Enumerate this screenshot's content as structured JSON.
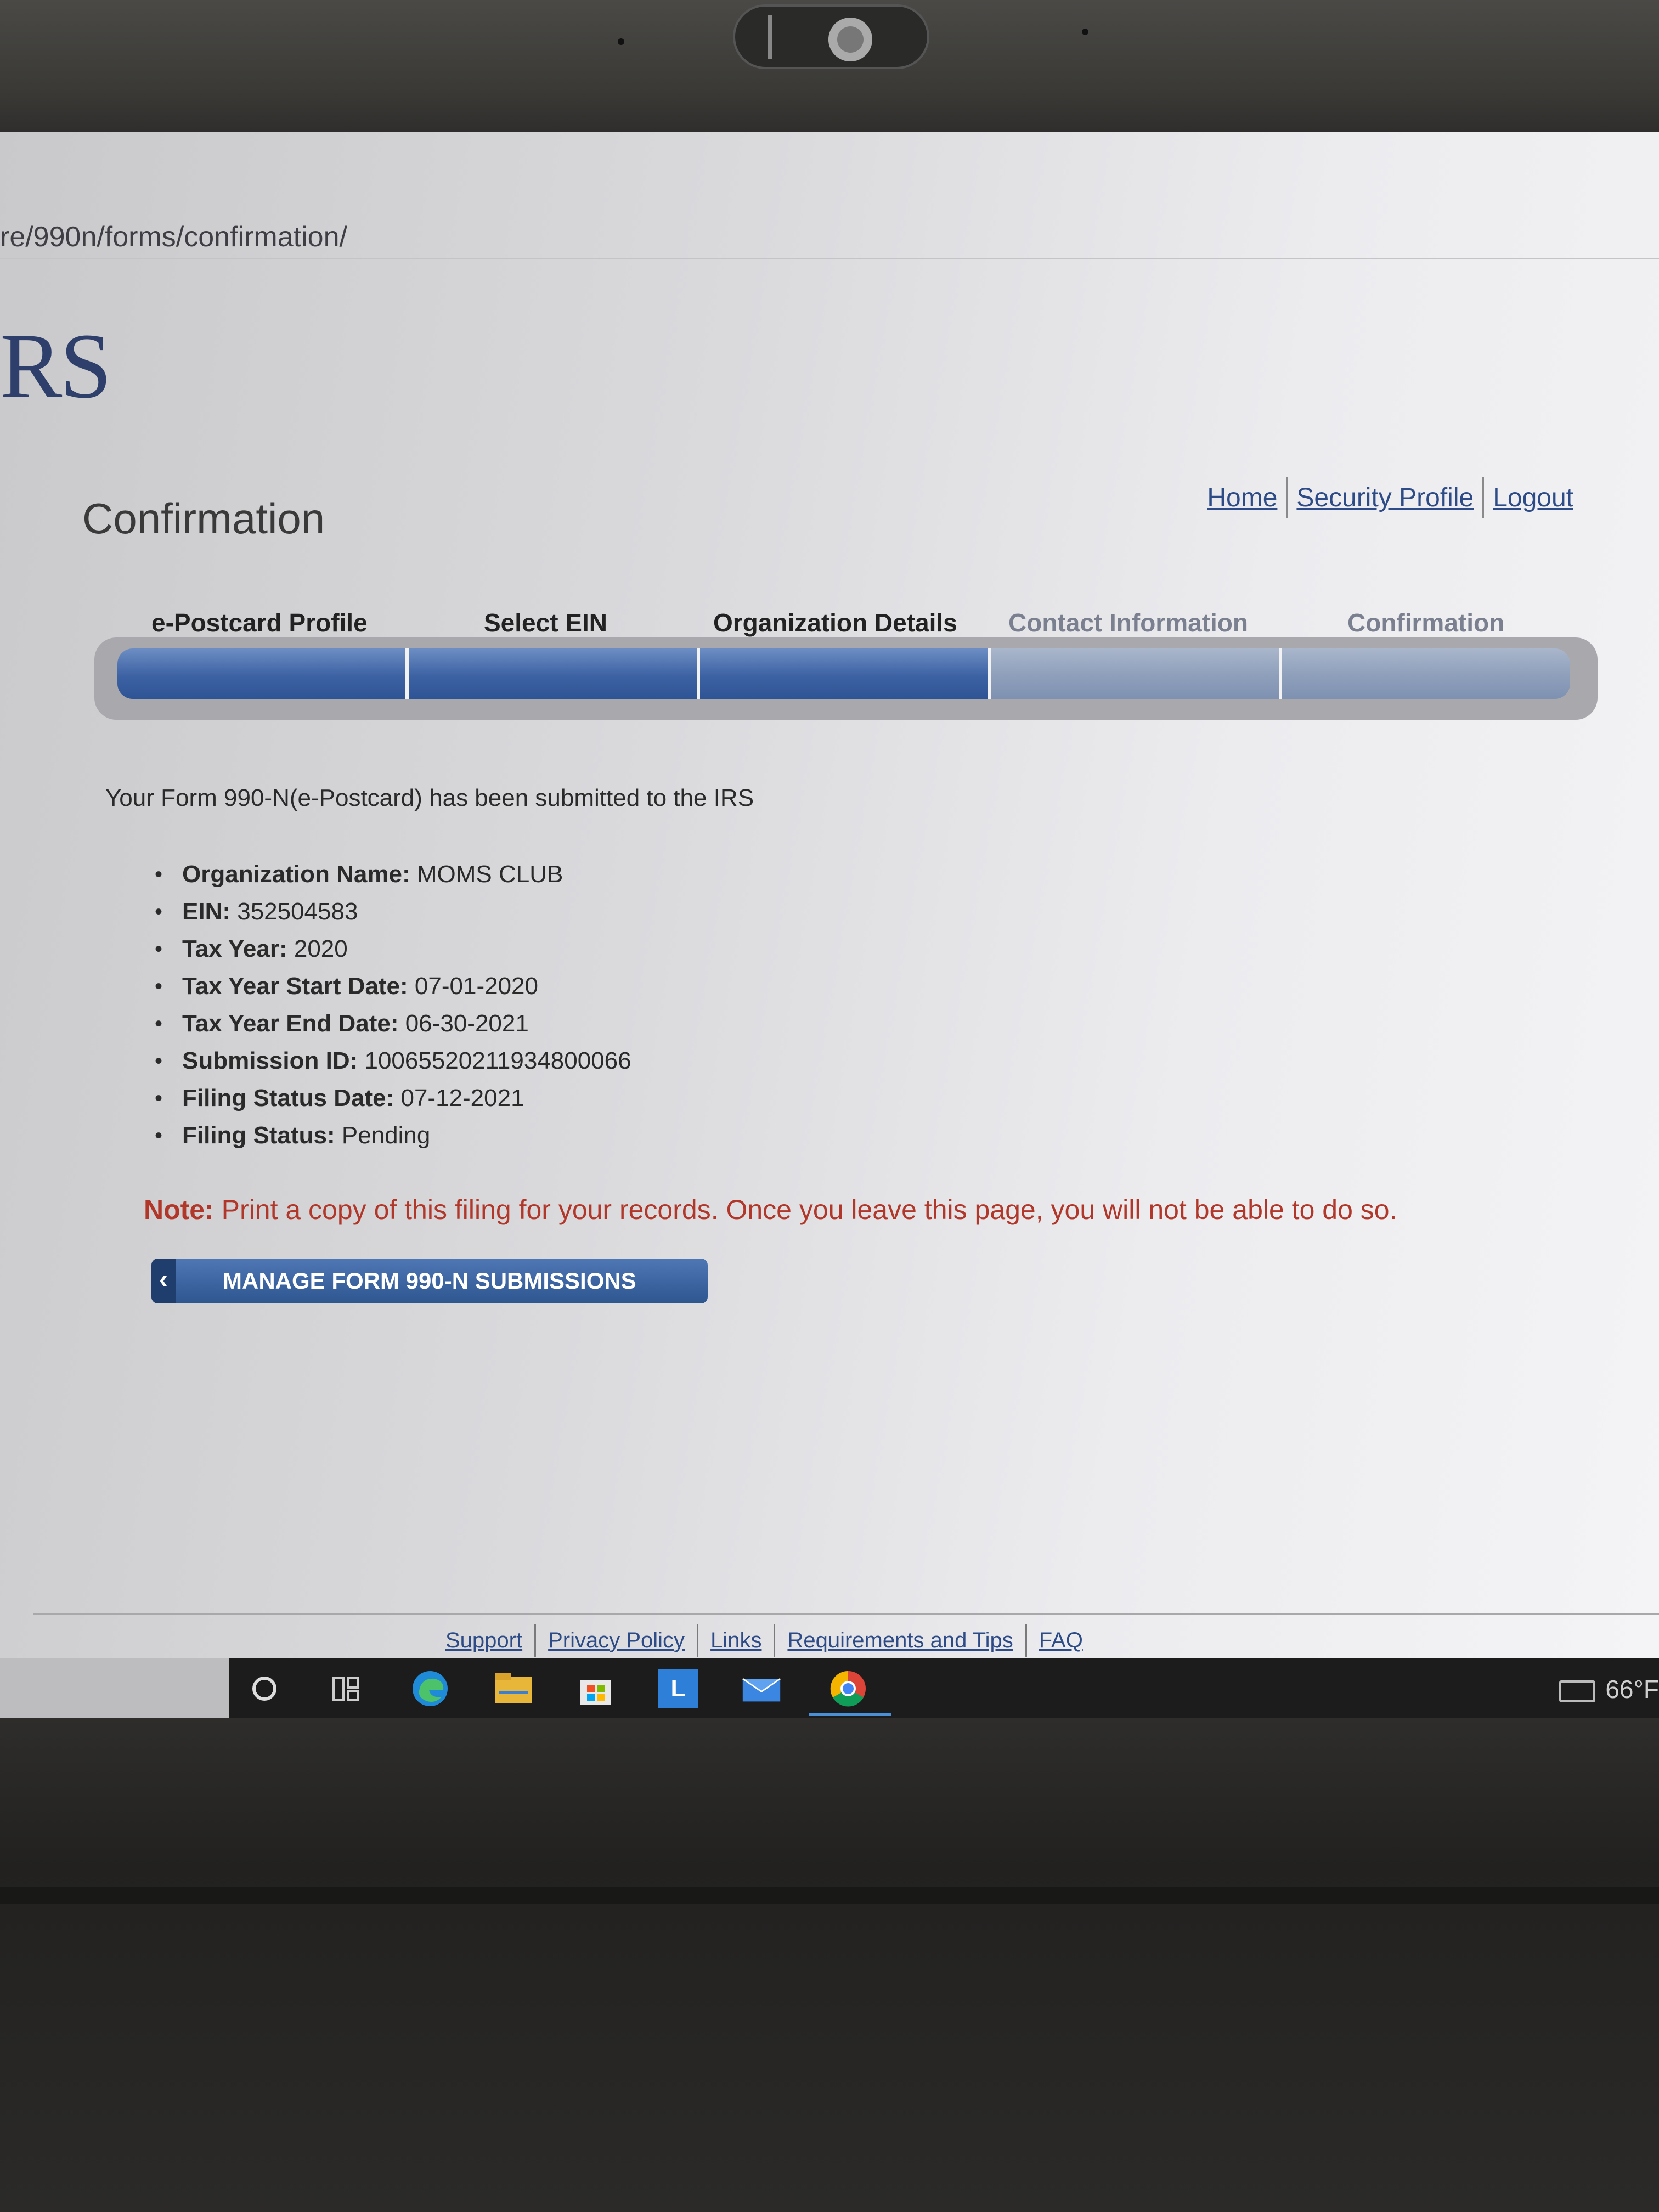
{
  "browser": {
    "url": "re/990n/forms/confirmation/"
  },
  "site": {
    "logo_text": "RS"
  },
  "page": {
    "title": "Confirmation"
  },
  "top_links": [
    "Home",
    "Security Profile",
    "Logout"
  ],
  "steps": [
    {
      "label": "e-Postcard Profile",
      "state": "complete"
    },
    {
      "label": "Select EIN",
      "state": "complete"
    },
    {
      "label": "Organization Details",
      "state": "complete"
    },
    {
      "label": "Contact Information",
      "state": "complete"
    },
    {
      "label": "Confirmation",
      "state": "current"
    }
  ],
  "confirmation": {
    "message": "Your Form 990-N(e-Postcard) has been submitted to the IRS",
    "details": [
      {
        "label": "Organization Name:",
        "value": " MOMS CLUB"
      },
      {
        "label": "EIN:",
        "value": " 352504583"
      },
      {
        "label": "Tax Year:",
        "value": " 2020"
      },
      {
        "label": "Tax Year Start Date:",
        "value": " 07-01-2020"
      },
      {
        "label": "Tax Year End Date:",
        "value": " 06-30-2021"
      },
      {
        "label": "Submission ID:",
        "value": " 10065520211934800066"
      },
      {
        "label": "Filing Status Date:",
        "value": " 07-12-2021"
      },
      {
        "label": "Filing Status:",
        "value": " Pending"
      }
    ],
    "note_label": "Note:",
    "note_text": " Print a copy of this filing for your records. Once you leave this page, you will not be able to do so.",
    "button_label": "MANAGE FORM 990-N SUBMISSIONS"
  },
  "footer_links": [
    "Support",
    "Privacy Policy",
    "Links",
    "Requirements and Tips",
    "FAQ"
  ],
  "taskbar": {
    "icons": [
      "search-icon",
      "task-view-icon",
      "edge-icon",
      "file-explorer-icon",
      "store-icon",
      "l-app-icon",
      "mail-icon",
      "chrome-icon"
    ],
    "l_app_letter": "L",
    "weather": "66°F"
  },
  "colors": {
    "accent_blue": "#2e568f",
    "note_red": "#b1372a",
    "link_blue": "#2d4b86"
  }
}
